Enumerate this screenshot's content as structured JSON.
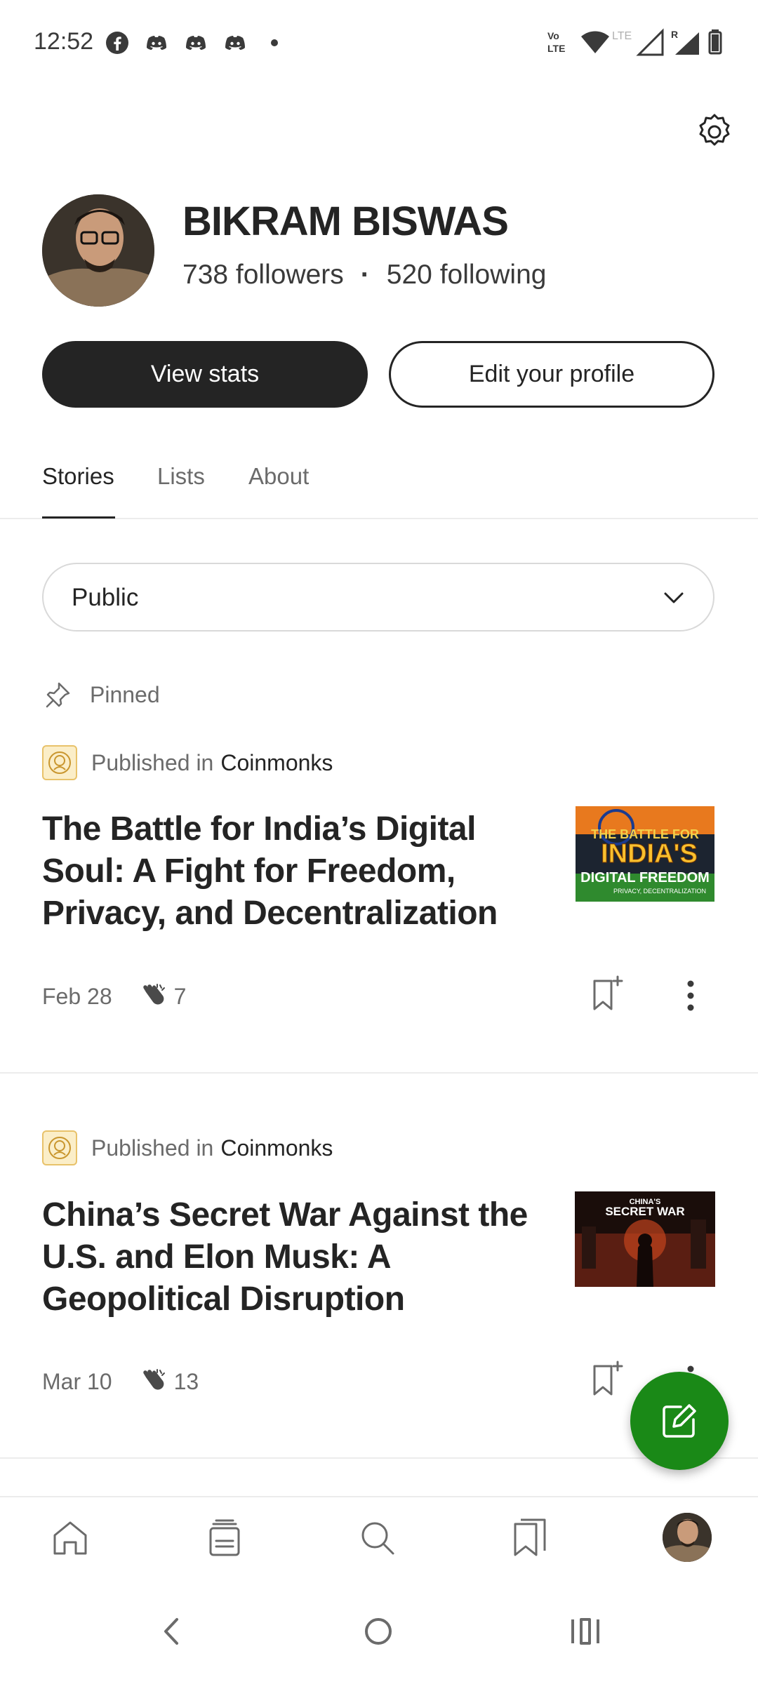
{
  "status_bar": {
    "time": "12:52",
    "notification_icons": [
      "facebook-icon",
      "discord-icon",
      "discord-icon",
      "discord-icon",
      "more-dot-icon"
    ],
    "right_labels": {
      "volte": "Vo LTE",
      "lte": "LTE",
      "roaming": "R"
    }
  },
  "profile": {
    "name": "BIKRAM BISWAS",
    "followers": "738 followers",
    "separator": "·",
    "following": "520 following"
  },
  "actions": {
    "view_stats": "View stats",
    "edit_profile": "Edit your profile"
  },
  "tabs": [
    "Stories",
    "Lists",
    "About"
  ],
  "active_tab": "Stories",
  "filter": {
    "value": "Public"
  },
  "pinned_label": "Pinned",
  "stories": [
    {
      "published_prefix": "Published in",
      "publication": "Coinmonks",
      "title": "The Battle for India’s Digital Soul: A Fight for Freedom, Privacy, and Decentralization",
      "thumb_text": [
        "THE BATTLE FOR",
        "INDIA'S",
        "DIGITAL FREEDOM",
        "PRIVACY, DECENTRALIZATION"
      ],
      "date": "Feb 28",
      "claps": "7"
    },
    {
      "published_prefix": "Published in",
      "publication": "Coinmonks",
      "title": "China’s Secret War Against the U.S. and Elon Musk: A Geopolitical Disruption",
      "thumb_text": [
        "CHINA'S",
        "SECRET WAR"
      ],
      "date": "Mar 10",
      "claps": "13"
    }
  ],
  "colors": {
    "primary_text": "#242424",
    "secondary_text": "#6b6b6b",
    "fab_green": "#1a8917",
    "divider": "#ececec"
  },
  "bottom_nav": [
    "home-icon",
    "following-feed-icon",
    "search-icon",
    "library-icon",
    "profile-avatar"
  ]
}
